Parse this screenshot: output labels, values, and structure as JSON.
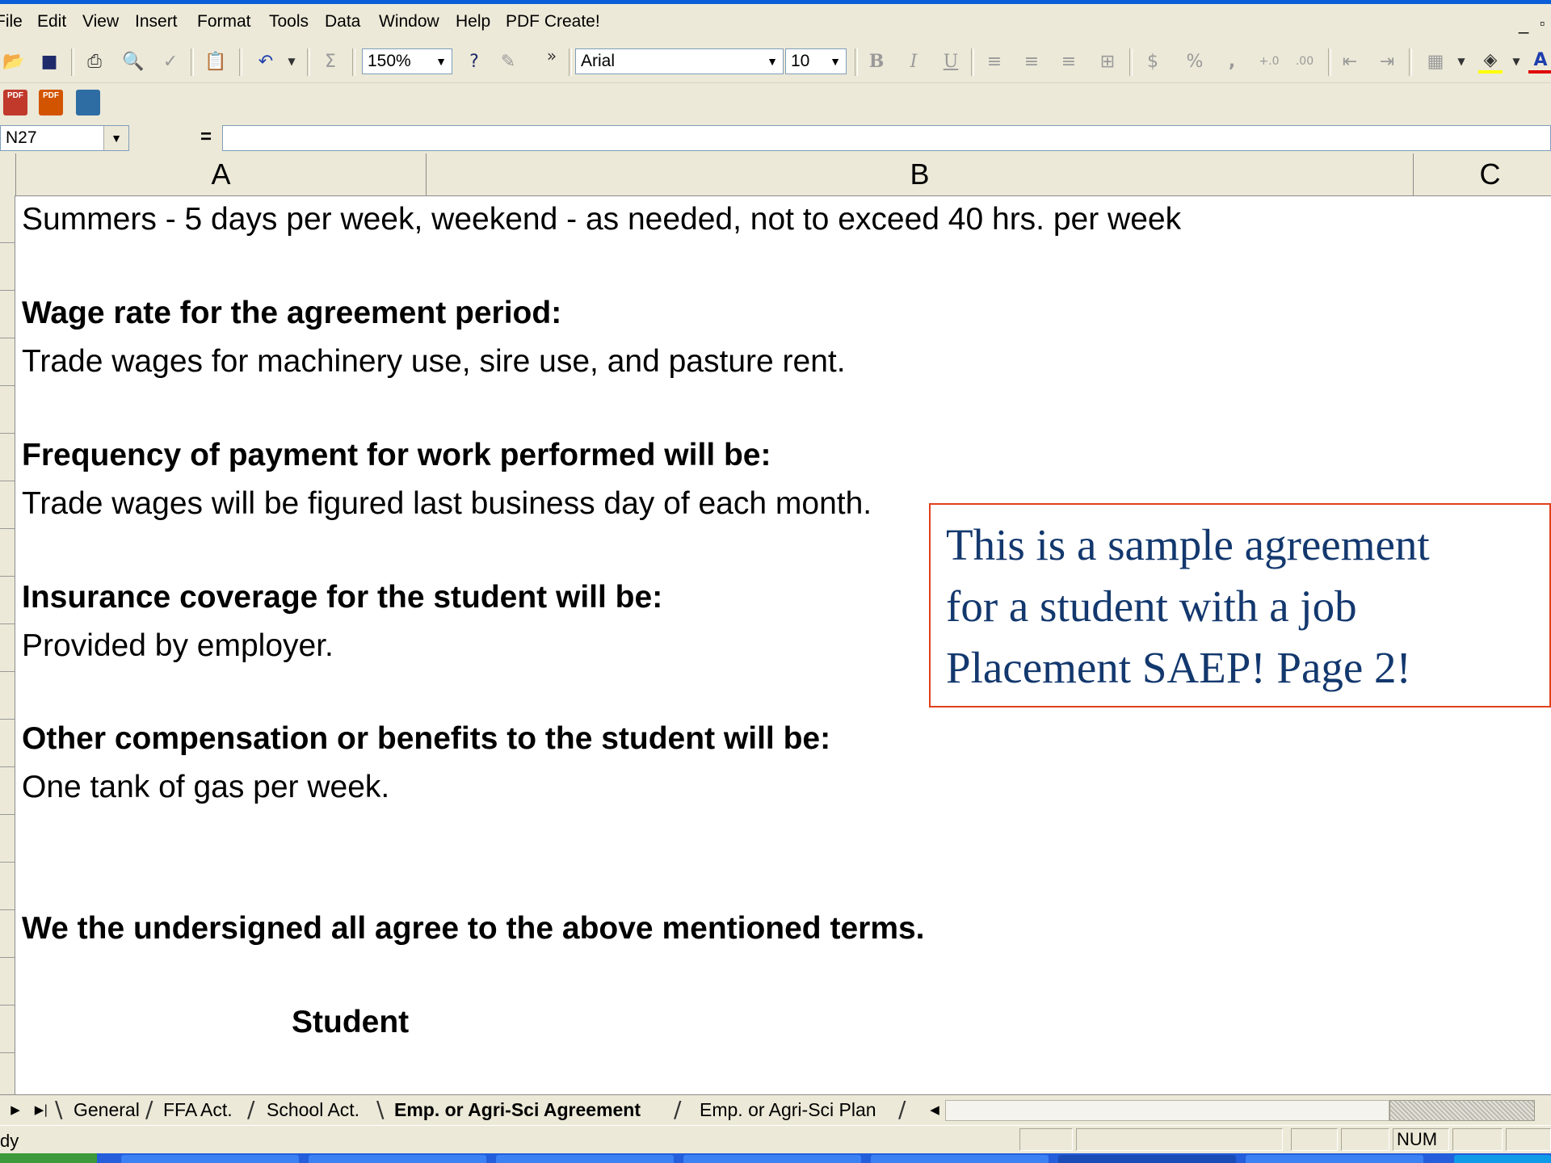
{
  "menu": [
    "File",
    "Edit",
    "View",
    "Insert",
    "Format",
    "Tools",
    "Data",
    "Window",
    "Help",
    "PDF Create!"
  ],
  "toolbar": {
    "zoom": "150%",
    "font_name": "Arial",
    "font_size": "10",
    "bold": "B",
    "italic": "I",
    "underline": "U",
    "currency": "$",
    "percent": "%",
    "comma": ",",
    "sum": "Σ",
    "more": "»"
  },
  "pdf_toolbar": {
    "icon_label": "PDF"
  },
  "formula_bar": {
    "cell_ref": "N27",
    "equals": "=",
    "formula": ""
  },
  "columns": [
    "A",
    "B",
    "C"
  ],
  "cells": [
    {
      "text": "Summers - 5 days per week, weekend - as needed, not to exceed 40 hrs. per week",
      "bold": false
    },
    {
      "text": "Wage rate for the agreement period:",
      "bold": true
    },
    {
      "text": "Trade wages for machinery use, sire use, and pasture rent.",
      "bold": false
    },
    {
      "text": "Frequency of payment for work performed will be:",
      "bold": true
    },
    {
      "text": "Trade wages will be figured last business day of each month.",
      "bold": false
    },
    {
      "text": "Insurance coverage for the student will be:",
      "bold": true
    },
    {
      "text": "Provided by employer.",
      "bold": false
    },
    {
      "text": "Other compensation or benefits to the student will be:",
      "bold": true
    },
    {
      "text": "One tank of gas per week.",
      "bold": false
    },
    {
      "text": "We the undersigned all agree to the above mentioned terms.",
      "bold": true
    },
    {
      "text": "Student",
      "bold": true
    }
  ],
  "callout": {
    "line1": "This is a sample agreement",
    "line2": "for a student with a job",
    "line3": "Placement SAEP! Page 2!"
  },
  "sheet_tabs": [
    {
      "label": "General",
      "active": false
    },
    {
      "label": "FFA Act.",
      "active": false
    },
    {
      "label": "School Act.",
      "active": false
    },
    {
      "label": "Emp. or Agri-Sci Agreement",
      "active": true
    },
    {
      "label": "Emp. or Agri-Sci Plan",
      "active": false
    }
  ],
  "status": {
    "text": "dy",
    "num": "NUM"
  },
  "colors": {
    "callout_border": "#e0401a",
    "callout_text": "#13386e",
    "chrome": "#ECE9D8",
    "taskbar": "#245edb"
  }
}
